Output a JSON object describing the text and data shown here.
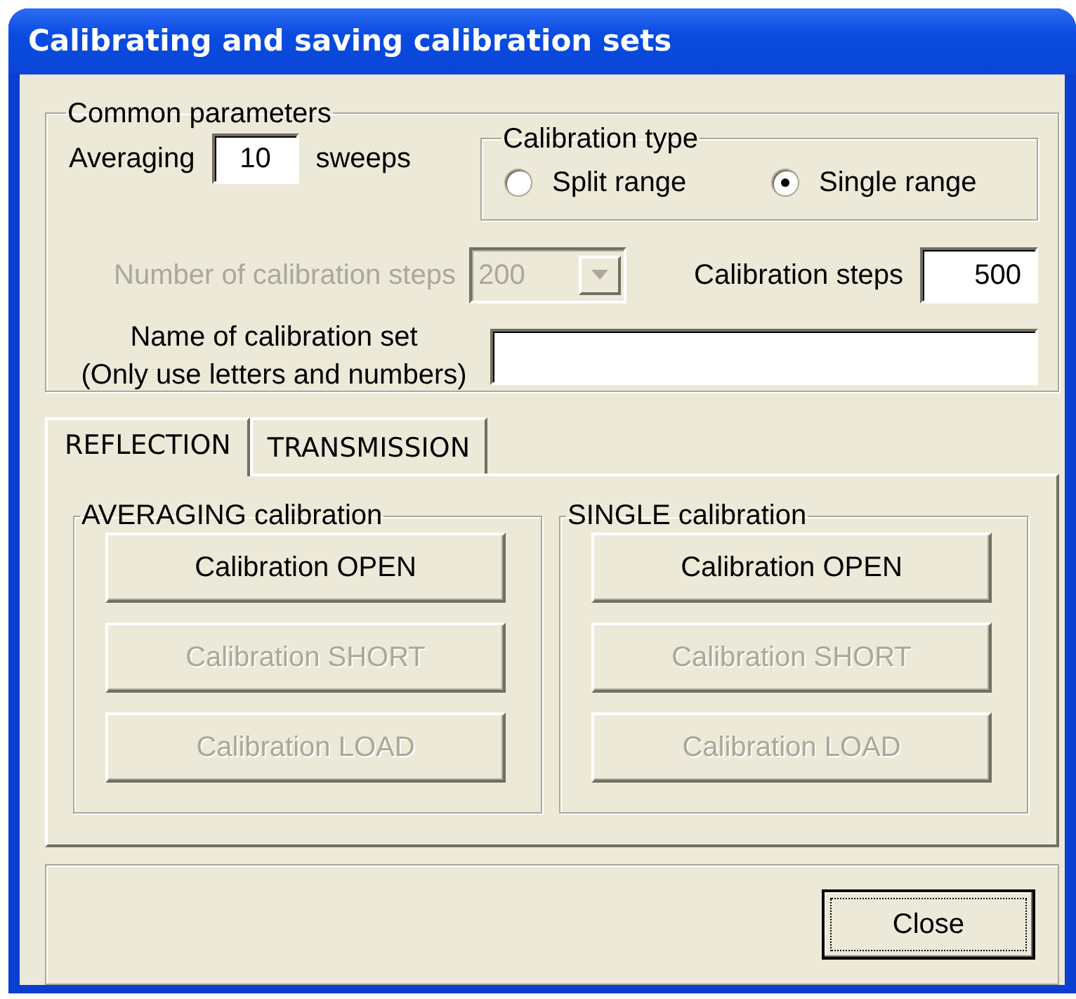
{
  "window": {
    "title": "Calibrating and saving calibration sets"
  },
  "common_parameters": {
    "legend": "Common parameters",
    "averaging": {
      "label": "Averaging",
      "value": "10",
      "unit": "sweeps"
    },
    "calibration_type": {
      "legend": "Calibration type",
      "options": [
        {
          "label": "Split range",
          "selected": false
        },
        {
          "label": "Single range",
          "selected": true
        }
      ]
    },
    "number_of_steps": {
      "label": "Number of calibration steps",
      "value": "200",
      "disabled": true
    },
    "calibration_steps": {
      "label": "Calibration steps",
      "value": "500"
    },
    "name": {
      "label_lines": [
        "Name of calibration set",
        "(Only use letters and numbers)"
      ]
    }
  },
  "tabs": [
    {
      "label": "REFLECTION",
      "selected": true
    },
    {
      "label": "TRANSMISSION",
      "selected": false
    }
  ],
  "groups": [
    {
      "legend": "AVERAGING calibration",
      "buttons": [
        {
          "label": "Calibration OPEN",
          "disabled": false
        },
        {
          "label": "Calibration SHORT",
          "disabled": true
        },
        {
          "label": "Calibration LOAD",
          "disabled": true
        }
      ]
    },
    {
      "legend": "SINGLE calibration",
      "buttons": [
        {
          "label": "Calibration OPEN",
          "disabled": false
        },
        {
          "label": "Calibration SHORT",
          "disabled": true
        },
        {
          "label": "Calibration LOAD",
          "disabled": true
        }
      ]
    }
  ],
  "buttons": [
    {
      "label": "Close",
      "focused": true
    }
  ]
}
